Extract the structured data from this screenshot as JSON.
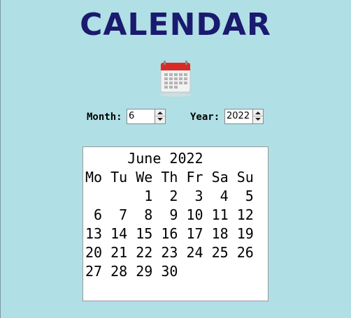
{
  "app": {
    "title": "CALENDAR"
  },
  "icon": {
    "name": "calendar-icon",
    "header_color": "#d62c24"
  },
  "controls": {
    "month_label": "Month:",
    "month_value": "6",
    "year_label": "Year:",
    "year_value": "2022"
  },
  "calendar": {
    "header": "     June 2022",
    "weekdays": "Mo Tu We Th Fr Sa Su",
    "weeks": [
      "       1  2  3  4  5",
      " 6  7  8  9 10 11 12",
      "13 14 15 16 17 18 19",
      "20 21 22 23 24 25 26",
      "27 28 29 30"
    ]
  },
  "colors": {
    "background": "#b0dfe5",
    "title": "#1a1a6e"
  }
}
